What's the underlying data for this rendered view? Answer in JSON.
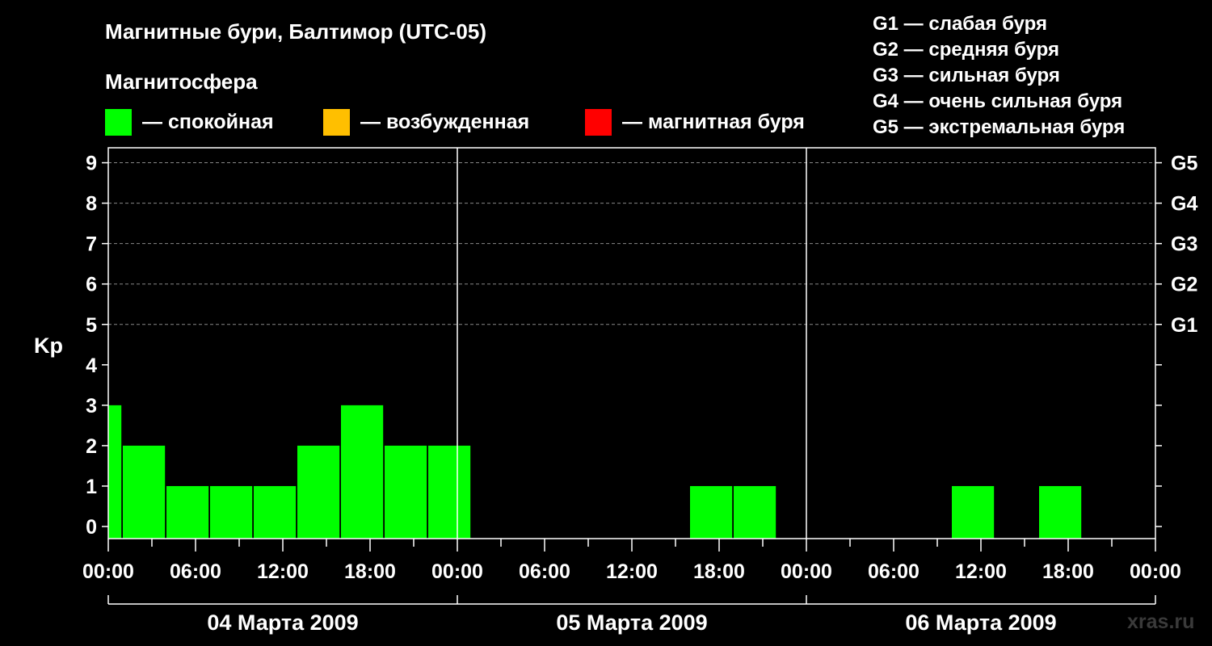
{
  "title": "Магнитные бури, Балтимор (UTC-05)",
  "magnetosphere_title": "Магнитосфера",
  "legend": [
    {
      "label": "— спокойная",
      "color": "#00ff00"
    },
    {
      "label": "— возбужденная",
      "color": "#ffbf00"
    },
    {
      "label": "— магнитная буря",
      "color": "#ff0000"
    }
  ],
  "g_legend": [
    "G1 — слабая буря",
    "G2 — средняя буря",
    "G3 — сильная буря",
    "G4 — очень сильная буря",
    "G5 — экстремальная буря"
  ],
  "watermark": "xras.ru",
  "chart_data": {
    "type": "bar",
    "ylabel": "Kp",
    "ylim": [
      -0.3,
      9.3
    ],
    "yticks": [
      "0",
      "1",
      "2",
      "3",
      "4",
      "5",
      "6",
      "7",
      "8",
      "9"
    ],
    "right_ticks": [
      {
        "kp": 5,
        "label": "G1"
      },
      {
        "kp": 6,
        "label": "G2"
      },
      {
        "kp": 7,
        "label": "G3"
      },
      {
        "kp": 8,
        "label": "G4"
      },
      {
        "kp": 9,
        "label": "G5"
      }
    ],
    "grid": "dashed horizontal at Kp 5–9",
    "xlim_hours": [
      0,
      72
    ],
    "x_tick_labels": [
      "00:00",
      "06:00",
      "12:00",
      "18:00",
      "00:00",
      "06:00",
      "12:00",
      "18:00",
      "00:00",
      "06:00",
      "12:00",
      "18:00",
      "00:00"
    ],
    "day_labels": [
      "04 Марта 2009",
      "05 Марта 2009",
      "06 Марта 2009"
    ],
    "bar_color": "#00ff00",
    "bars": [
      {
        "start_h": 0,
        "end_h": 0.9,
        "kp": 3
      },
      {
        "start_h": 1,
        "end_h": 3.9,
        "kp": 2
      },
      {
        "start_h": 4,
        "end_h": 6.9,
        "kp": 1
      },
      {
        "start_h": 7,
        "end_h": 9.9,
        "kp": 1
      },
      {
        "start_h": 10,
        "end_h": 12.9,
        "kp": 1
      },
      {
        "start_h": 13,
        "end_h": 15.9,
        "kp": 2
      },
      {
        "start_h": 16,
        "end_h": 18.9,
        "kp": 3
      },
      {
        "start_h": 19,
        "end_h": 21.9,
        "kp": 2
      },
      {
        "start_h": 22,
        "end_h": 24.9,
        "kp": 2
      },
      {
        "start_h": 40,
        "end_h": 42.9,
        "kp": 1
      },
      {
        "start_h": 43,
        "end_h": 45.9,
        "kp": 1
      },
      {
        "start_h": 58,
        "end_h": 60.9,
        "kp": 1
      },
      {
        "start_h": 64,
        "end_h": 66.9,
        "kp": 1
      }
    ]
  }
}
